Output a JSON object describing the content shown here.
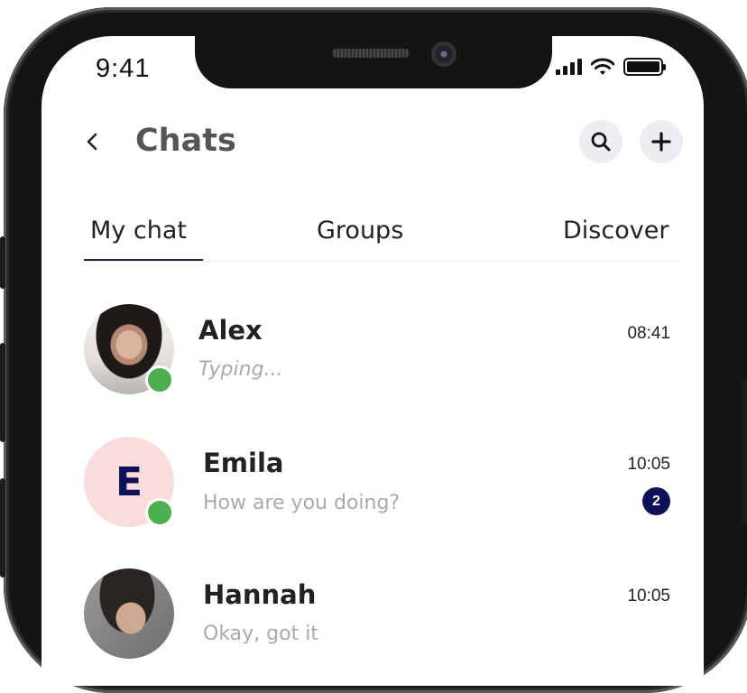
{
  "status_bar": {
    "time": "9:41"
  },
  "header": {
    "title": "Chats"
  },
  "tabs": [
    {
      "label": "My chat",
      "active": true
    },
    {
      "label": "Groups",
      "active": false
    },
    {
      "label": "Discover",
      "active": false
    }
  ],
  "chats": [
    {
      "name": "Alex",
      "time": "08:41",
      "preview": "Typing...",
      "online": true,
      "avatar": "photo"
    },
    {
      "name": "Emila",
      "time": "10:05",
      "preview": "How are you doing?",
      "online": true,
      "avatar_initial": "E",
      "unread": "2"
    },
    {
      "name": "Hannah",
      "time": "10:05",
      "preview": "Okay, got it",
      "online": false,
      "avatar": "photo"
    }
  ],
  "colors": {
    "accent": "#0d1257",
    "online": "#4caf50",
    "avatar_initial_bg": "#f9dcdc",
    "icon_button_bg": "#eeeef2"
  },
  "icons": {
    "back": "chevron-left-icon",
    "search": "search-icon",
    "add": "plus-icon",
    "signal": "signal-icon",
    "wifi": "wifi-icon",
    "battery": "battery-icon"
  }
}
